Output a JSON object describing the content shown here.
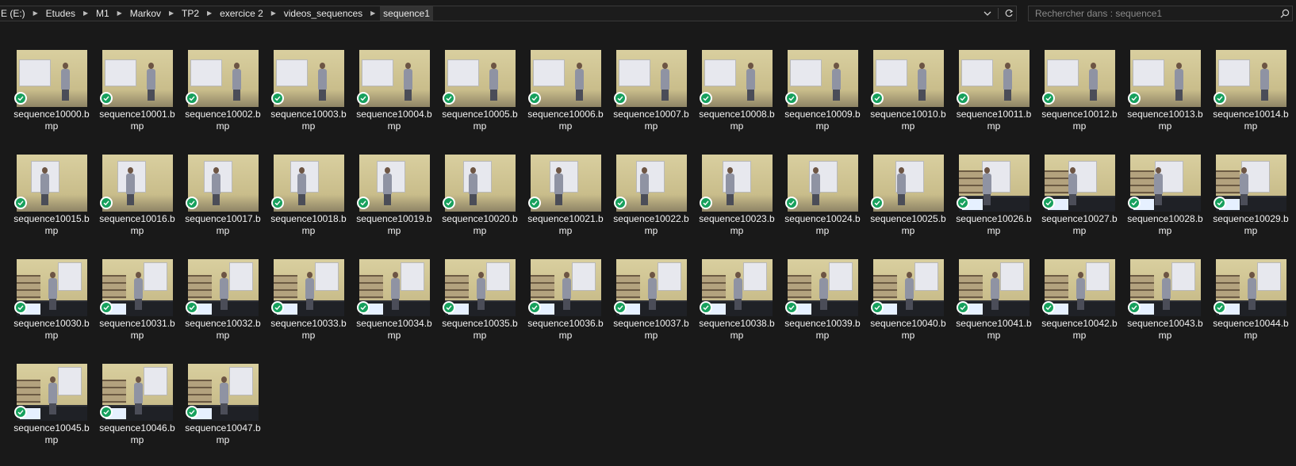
{
  "address_bar": {
    "breadcrumbs": [
      "E (E:)",
      "Etudes",
      "M1",
      "Markov",
      "TP2",
      "exercice 2",
      "videos_sequences",
      "sequence1"
    ]
  },
  "search": {
    "placeholder": "Rechercher dans : sequence1"
  },
  "icons": {
    "separator": "chevron-right-icon",
    "history": "chevron-down-icon",
    "refresh": "refresh-icon",
    "search": "search-icon",
    "status": "sync-check-icon"
  },
  "colors": {
    "background": "#191919",
    "status_green": "#17a05d",
    "selected_crumb": "#333333"
  },
  "files": [
    {
      "name": "sequence10000.bmp"
    },
    {
      "name": "sequence10001.bmp"
    },
    {
      "name": "sequence10002.bmp"
    },
    {
      "name": "sequence10003.bmp"
    },
    {
      "name": "sequence10004.bmp"
    },
    {
      "name": "sequence10005.bmp"
    },
    {
      "name": "sequence10006.bmp"
    },
    {
      "name": "sequence10007.bmp"
    },
    {
      "name": "sequence10008.bmp"
    },
    {
      "name": "sequence10009.bmp"
    },
    {
      "name": "sequence10010.bmp"
    },
    {
      "name": "sequence10011.bmp"
    },
    {
      "name": "sequence10012.bmp"
    },
    {
      "name": "sequence10013.bmp"
    },
    {
      "name": "sequence10014.bmp"
    },
    {
      "name": "sequence10015.bmp"
    },
    {
      "name": "sequence10016.bmp"
    },
    {
      "name": "sequence10017.bmp"
    },
    {
      "name": "sequence10018.bmp"
    },
    {
      "name": "sequence10019.bmp"
    },
    {
      "name": "sequence10020.bmp"
    },
    {
      "name": "sequence10021.bmp"
    },
    {
      "name": "sequence10022.bmp"
    },
    {
      "name": "sequence10023.bmp"
    },
    {
      "name": "sequence10024.bmp"
    },
    {
      "name": "sequence10025.bmp"
    },
    {
      "name": "sequence10026.bmp"
    },
    {
      "name": "sequence10027.bmp"
    },
    {
      "name": "sequence10028.bmp"
    },
    {
      "name": "sequence10029.bmp"
    },
    {
      "name": "sequence10030.bmp"
    },
    {
      "name": "sequence10031.bmp"
    },
    {
      "name": "sequence10032.bmp"
    },
    {
      "name": "sequence10033.bmp"
    },
    {
      "name": "sequence10034.bmp"
    },
    {
      "name": "sequence10035.bmp"
    },
    {
      "name": "sequence10036.bmp"
    },
    {
      "name": "sequence10037.bmp"
    },
    {
      "name": "sequence10038.bmp"
    },
    {
      "name": "sequence10039.bmp"
    },
    {
      "name": "sequence10040.bmp"
    },
    {
      "name": "sequence10041.bmp"
    },
    {
      "name": "sequence10042.bmp"
    },
    {
      "name": "sequence10043.bmp"
    },
    {
      "name": "sequence10044.bmp"
    },
    {
      "name": "sequence10045.bmp"
    },
    {
      "name": "sequence10046.bmp"
    },
    {
      "name": "sequence10047.bmp"
    }
  ]
}
